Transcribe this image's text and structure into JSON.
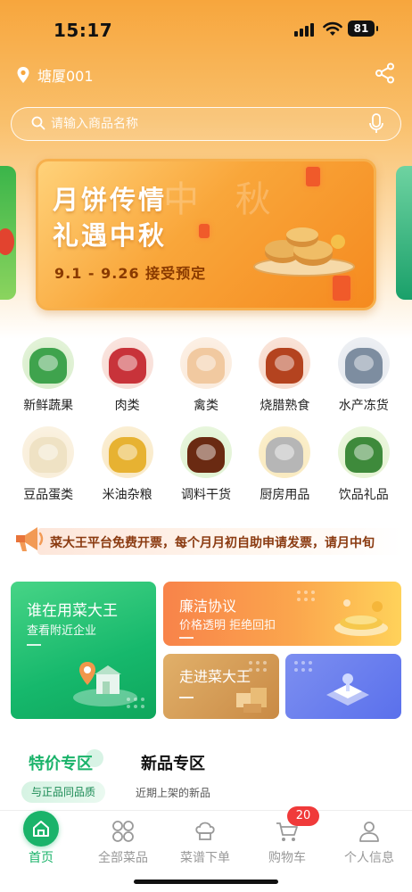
{
  "status_bar": {
    "time": "15:17",
    "battery": "81"
  },
  "header": {
    "location": "塘厦001",
    "icons": [
      "location-pin-icon",
      "share-icon"
    ]
  },
  "search": {
    "placeholder": "请输入商品名称",
    "icons": [
      "search-icon",
      "microphone-icon"
    ]
  },
  "banner": {
    "title_line1": "月饼传情",
    "title_line2": "礼遇中秋",
    "decor_text": "中 秋",
    "date_text": "9.1 - 9.26 接受预定"
  },
  "categories": [
    {
      "label": "新鲜蔬果",
      "color": "#3fa34d"
    },
    {
      "label": "肉类",
      "color": "#c8333a"
    },
    {
      "label": "禽类",
      "color": "#f1c9a0"
    },
    {
      "label": "烧腊熟食",
      "color": "#b4431f"
    },
    {
      "label": "水产冻货",
      "color": "#7d8da0"
    },
    {
      "label": "豆品蛋类",
      "color": "#efe2c4"
    },
    {
      "label": "米油杂粮",
      "color": "#e7b232"
    },
    {
      "label": "调料干货",
      "color": "#6a2a12"
    },
    {
      "label": "厨房用品",
      "color": "#b6b6b6"
    },
    {
      "label": "饮品礼品",
      "color": "#3e8a3b"
    }
  ],
  "notice": {
    "text": "菜大王平台免费开票，每个月月初自助申请发票，请月中旬"
  },
  "promos": {
    "green": {
      "title": "谁在用菜大王",
      "subtitle": "查看附近企业"
    },
    "orange": {
      "title": "廉洁协议",
      "subtitle": "价格透明 拒绝回扣"
    },
    "brown": {
      "title": "走进菜大王"
    },
    "blue": {}
  },
  "tabs": {
    "special": {
      "label": "特价专区",
      "subtitle": "与正品同品质"
    },
    "new": {
      "label": "新品专区",
      "subtitle": "近期上架的新品"
    }
  },
  "bottom_nav": {
    "items": [
      {
        "label": "首页",
        "icon": "home-icon",
        "active": true
      },
      {
        "label": "全部菜品",
        "icon": "grid-icon"
      },
      {
        "label": "菜谱下单",
        "icon": "chef-hat-icon"
      },
      {
        "label": "购物车",
        "icon": "cart-icon"
      },
      {
        "label": "个人信息",
        "icon": "user-icon"
      }
    ],
    "cart_badge": "20"
  },
  "colors": {
    "accent_green": "#1ab36a",
    "header_orange": "#f7a63d",
    "badge_red": "#f03a3a"
  }
}
